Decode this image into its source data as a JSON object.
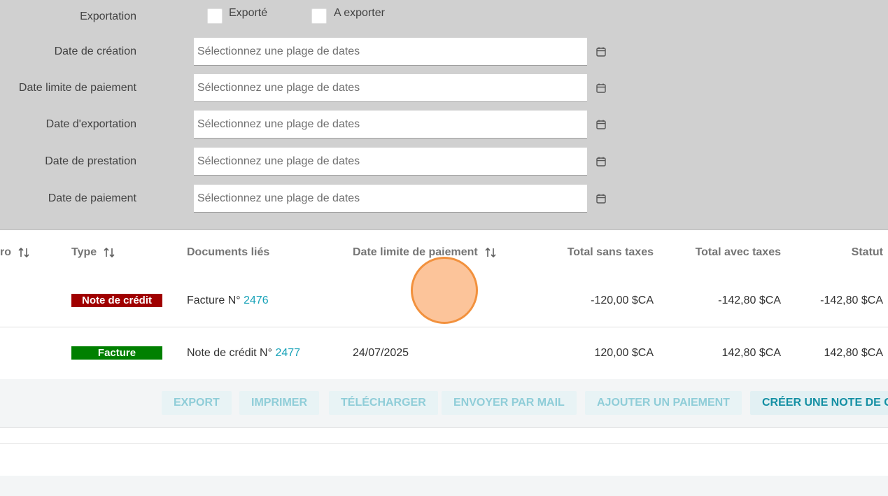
{
  "filters": {
    "exportation_label": "Exportation",
    "exported_label": "Exporté",
    "to_export_label": "A exporter",
    "date_rows": [
      {
        "label": "Date de création",
        "placeholder": "Sélectionnez une plage de dates"
      },
      {
        "label": "Date limite de paiement",
        "placeholder": "Sélectionnez une plage de dates"
      },
      {
        "label": "Date d'exportation",
        "placeholder": "Sélectionnez une plage de dates"
      },
      {
        "label": "Date de prestation",
        "placeholder": "Sélectionnez une plage de dates"
      },
      {
        "label": "Date de paiement",
        "placeholder": "Sélectionnez une plage de dates"
      }
    ],
    "calendar_icon": "calendar-icon"
  },
  "table": {
    "headers": {
      "numero": "ro",
      "type": "Type",
      "documents": "Documents liés",
      "due_date": "Date limite de paiement",
      "total_excl": "Total sans taxes",
      "total_incl": "Total avec taxes",
      "status": "Statut"
    },
    "sort_icon": "sort-arrows-icon",
    "rows": [
      {
        "type": "Note de crédit",
        "type_color": "#a00000",
        "doc_prefix": "Facture N°",
        "doc_number": "2476",
        "due_date": "",
        "total_excl": "-120,00 $CA",
        "total_incl": "-142,80 $CA",
        "status": "-142,80 $CA"
      },
      {
        "type": "Facture",
        "type_color": "#008000",
        "doc_prefix": "Note de crédit N°",
        "doc_number": "2477",
        "due_date": "24/07/2025",
        "total_excl": "120,00 $CA",
        "total_incl": "142,80 $CA",
        "status": "142,80 $CA"
      }
    ]
  },
  "actions": {
    "export": "EXPORT",
    "print": "IMPRIMER",
    "download": "TÉLÉCHARGER",
    "email": "ENVOYER PAR MAIL",
    "add_payment": "AJOUTER UN PAIEMENT",
    "create_credit_note": "CRÉER UNE NOTE DE CR"
  },
  "colors": {
    "panel_bg": "#d0d0d0",
    "link": "#17a2b8",
    "credit_note_badge": "#a00000",
    "invoice_badge": "#008000",
    "cursor_highlight": "#f2913d"
  }
}
